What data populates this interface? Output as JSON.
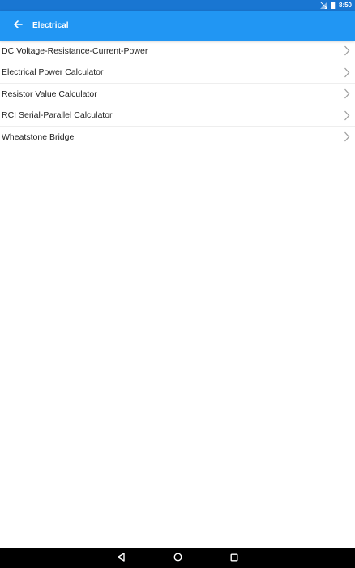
{
  "status_bar": {
    "time": "8:50",
    "background": "#1976d2"
  },
  "app_bar": {
    "title": "Electrical",
    "background": "#2196f3",
    "back_icon": "arrow-left-icon"
  },
  "list": {
    "items": [
      {
        "label": "DC Voltage-Resistance-Current-Power"
      },
      {
        "label": "Electrical Power Calculator"
      },
      {
        "label": "Resistor Value Calculator"
      },
      {
        "label": "RCI Serial-Parallel Calculator"
      },
      {
        "label": "Wheatstone Bridge"
      }
    ],
    "chevron_icon": "chevron-right-icon"
  },
  "nav_bar": {
    "buttons": [
      "back-triangle-icon",
      "home-circle-icon",
      "recents-square-icon"
    ]
  }
}
